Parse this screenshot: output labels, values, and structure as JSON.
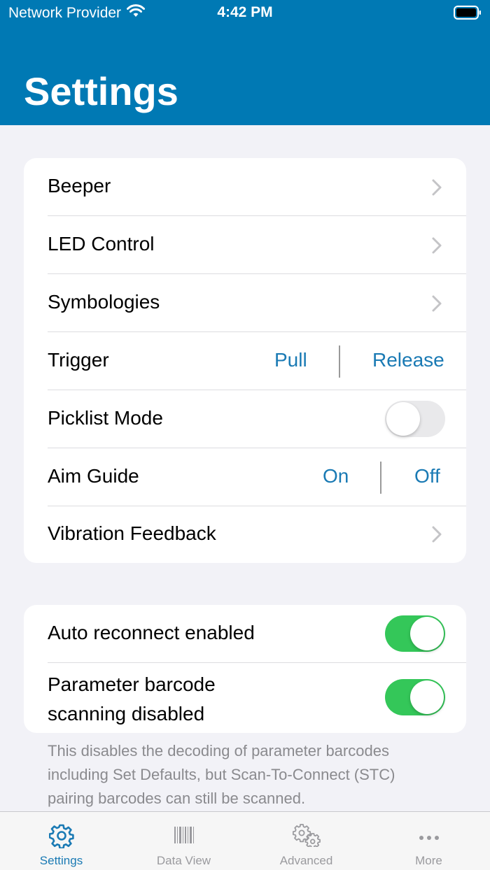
{
  "status_bar": {
    "carrier": "Network Provider",
    "time": "4:42 PM"
  },
  "header": {
    "title": "Settings",
    "background": "#0079b4"
  },
  "settings_group": {
    "rows": [
      {
        "label": "Beeper",
        "type": "disclosure"
      },
      {
        "label": "LED Control",
        "type": "disclosure"
      },
      {
        "label": "Symbologies",
        "type": "disclosure"
      },
      {
        "label": "Trigger",
        "type": "segmented",
        "options": [
          "Pull",
          "Release"
        ]
      },
      {
        "label": "Picklist Mode",
        "type": "toggle",
        "value": false
      },
      {
        "label": "Aim Guide",
        "type": "segmented",
        "options": [
          "On",
          "Off"
        ]
      },
      {
        "label": "Vibration Feedback",
        "type": "disclosure"
      }
    ]
  },
  "connection_group": {
    "rows": [
      {
        "label": "Auto reconnect enabled",
        "type": "toggle",
        "value": true
      },
      {
        "label_line1": "Parameter barcode",
        "label_line2": "scanning disabled",
        "type": "toggle",
        "value": true
      }
    ],
    "footnote_line1": "This disables the decoding of parameter barcodes",
    "footnote_line2": "including Set Defaults, but Scan-To-Connect (STC)",
    "footnote_line3": "pairing barcodes can still be scanned."
  },
  "tab_bar": {
    "tabs": [
      {
        "label": "Settings",
        "icon": "gear-icon",
        "active": true
      },
      {
        "label": "Data View",
        "icon": "barcode-icon",
        "active": false
      },
      {
        "label": "Advanced",
        "icon": "gears-icon",
        "active": false
      },
      {
        "label": "More",
        "icon": "ellipsis-icon",
        "active": false
      }
    ]
  },
  "colors": {
    "accent": "#1a7ab4",
    "toggle_on": "#34c759",
    "toggle_off": "#e9e9eb"
  }
}
